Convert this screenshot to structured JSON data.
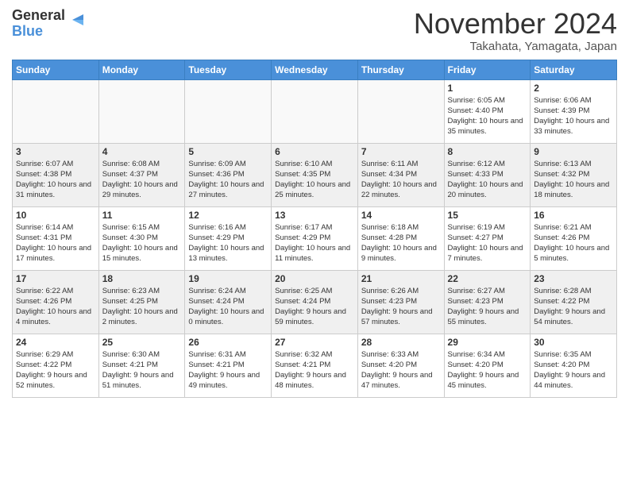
{
  "header": {
    "logo_line1": "General",
    "logo_line2": "Blue",
    "month": "November 2024",
    "location": "Takahata, Yamagata, Japan"
  },
  "weekdays": [
    "Sunday",
    "Monday",
    "Tuesday",
    "Wednesday",
    "Thursday",
    "Friday",
    "Saturday"
  ],
  "weeks": [
    [
      {
        "day": "",
        "info": "",
        "empty": true
      },
      {
        "day": "",
        "info": "",
        "empty": true
      },
      {
        "day": "",
        "info": "",
        "empty": true
      },
      {
        "day": "",
        "info": "",
        "empty": true
      },
      {
        "day": "",
        "info": "",
        "empty": true
      },
      {
        "day": "1",
        "info": "Sunrise: 6:05 AM\nSunset: 4:40 PM\nDaylight: 10 hours and 35 minutes."
      },
      {
        "day": "2",
        "info": "Sunrise: 6:06 AM\nSunset: 4:39 PM\nDaylight: 10 hours and 33 minutes."
      }
    ],
    [
      {
        "day": "3",
        "info": "Sunrise: 6:07 AM\nSunset: 4:38 PM\nDaylight: 10 hours and 31 minutes."
      },
      {
        "day": "4",
        "info": "Sunrise: 6:08 AM\nSunset: 4:37 PM\nDaylight: 10 hours and 29 minutes."
      },
      {
        "day": "5",
        "info": "Sunrise: 6:09 AM\nSunset: 4:36 PM\nDaylight: 10 hours and 27 minutes."
      },
      {
        "day": "6",
        "info": "Sunrise: 6:10 AM\nSunset: 4:35 PM\nDaylight: 10 hours and 25 minutes."
      },
      {
        "day": "7",
        "info": "Sunrise: 6:11 AM\nSunset: 4:34 PM\nDaylight: 10 hours and 22 minutes."
      },
      {
        "day": "8",
        "info": "Sunrise: 6:12 AM\nSunset: 4:33 PM\nDaylight: 10 hours and 20 minutes."
      },
      {
        "day": "9",
        "info": "Sunrise: 6:13 AM\nSunset: 4:32 PM\nDaylight: 10 hours and 18 minutes."
      }
    ],
    [
      {
        "day": "10",
        "info": "Sunrise: 6:14 AM\nSunset: 4:31 PM\nDaylight: 10 hours and 17 minutes."
      },
      {
        "day": "11",
        "info": "Sunrise: 6:15 AM\nSunset: 4:30 PM\nDaylight: 10 hours and 15 minutes."
      },
      {
        "day": "12",
        "info": "Sunrise: 6:16 AM\nSunset: 4:29 PM\nDaylight: 10 hours and 13 minutes."
      },
      {
        "day": "13",
        "info": "Sunrise: 6:17 AM\nSunset: 4:29 PM\nDaylight: 10 hours and 11 minutes."
      },
      {
        "day": "14",
        "info": "Sunrise: 6:18 AM\nSunset: 4:28 PM\nDaylight: 10 hours and 9 minutes."
      },
      {
        "day": "15",
        "info": "Sunrise: 6:19 AM\nSunset: 4:27 PM\nDaylight: 10 hours and 7 minutes."
      },
      {
        "day": "16",
        "info": "Sunrise: 6:21 AM\nSunset: 4:26 PM\nDaylight: 10 hours and 5 minutes."
      }
    ],
    [
      {
        "day": "17",
        "info": "Sunrise: 6:22 AM\nSunset: 4:26 PM\nDaylight: 10 hours and 4 minutes."
      },
      {
        "day": "18",
        "info": "Sunrise: 6:23 AM\nSunset: 4:25 PM\nDaylight: 10 hours and 2 minutes."
      },
      {
        "day": "19",
        "info": "Sunrise: 6:24 AM\nSunset: 4:24 PM\nDaylight: 10 hours and 0 minutes."
      },
      {
        "day": "20",
        "info": "Sunrise: 6:25 AM\nSunset: 4:24 PM\nDaylight: 9 hours and 59 minutes."
      },
      {
        "day": "21",
        "info": "Sunrise: 6:26 AM\nSunset: 4:23 PM\nDaylight: 9 hours and 57 minutes."
      },
      {
        "day": "22",
        "info": "Sunrise: 6:27 AM\nSunset: 4:23 PM\nDaylight: 9 hours and 55 minutes."
      },
      {
        "day": "23",
        "info": "Sunrise: 6:28 AM\nSunset: 4:22 PM\nDaylight: 9 hours and 54 minutes."
      }
    ],
    [
      {
        "day": "24",
        "info": "Sunrise: 6:29 AM\nSunset: 4:22 PM\nDaylight: 9 hours and 52 minutes."
      },
      {
        "day": "25",
        "info": "Sunrise: 6:30 AM\nSunset: 4:21 PM\nDaylight: 9 hours and 51 minutes."
      },
      {
        "day": "26",
        "info": "Sunrise: 6:31 AM\nSunset: 4:21 PM\nDaylight: 9 hours and 49 minutes."
      },
      {
        "day": "27",
        "info": "Sunrise: 6:32 AM\nSunset: 4:21 PM\nDaylight: 9 hours and 48 minutes."
      },
      {
        "day": "28",
        "info": "Sunrise: 6:33 AM\nSunset: 4:20 PM\nDaylight: 9 hours and 47 minutes."
      },
      {
        "day": "29",
        "info": "Sunrise: 6:34 AM\nSunset: 4:20 PM\nDaylight: 9 hours and 45 minutes."
      },
      {
        "day": "30",
        "info": "Sunrise: 6:35 AM\nSunset: 4:20 PM\nDaylight: 9 hours and 44 minutes."
      }
    ]
  ]
}
